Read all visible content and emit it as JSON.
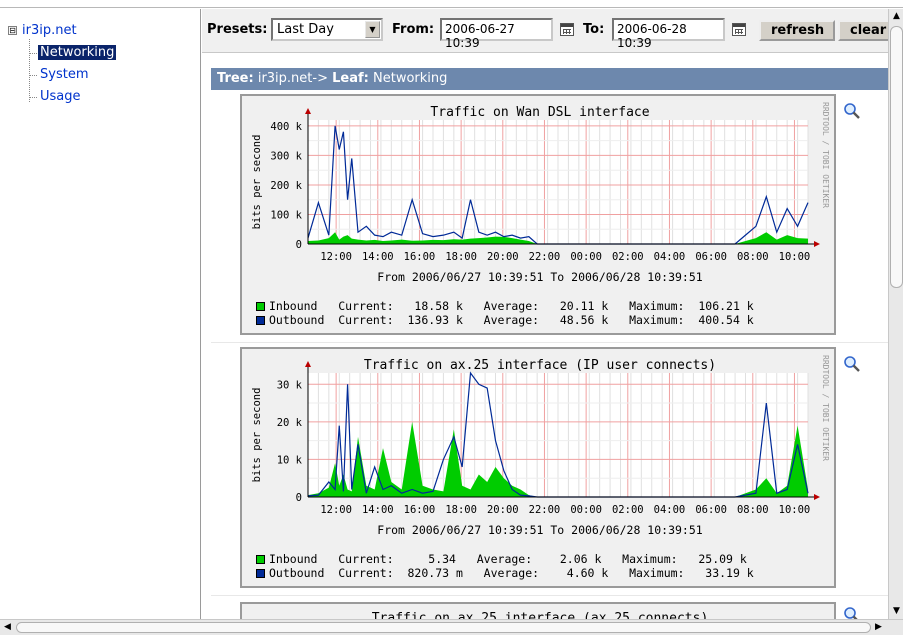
{
  "tree": {
    "root": "ir3ip.net",
    "expander": "⊟",
    "items": [
      "Networking",
      "System",
      "Usage"
    ],
    "selected_index": 0
  },
  "toolbar": {
    "presets_label": "Presets:",
    "preset_value": "Last Day",
    "from_label": "From:",
    "from_value": "2006-06-27 10:39",
    "to_label": "To:",
    "to_value": "2006-06-28 10:39",
    "refresh_label": "refresh",
    "clear_label": "clear"
  },
  "header": {
    "tree_label": "Tree:",
    "tree_value": "ir3ip.net->",
    "leaf_label": "Leaf:",
    "leaf_value": "Networking"
  },
  "colors": {
    "inbound": "#00cc00",
    "outbound": "#002a97",
    "header_bg": "#6d88ad",
    "selected_bg": "#0a246a"
  },
  "graphs": [
    {
      "title": "Traffic on Wan DSL interface",
      "watermark": "RRDTOOL / TOBI OETIKER",
      "period": "From 2006/06/27 10:39:51 To 2006/06/28 10:39:51",
      "legend": [
        {
          "name": "Inbound",
          "current": "18.58 k",
          "average": "20.11 k",
          "maximum": "106.21 k"
        },
        {
          "name": "Outbound",
          "current": "136.93 k",
          "average": "48.56 k",
          "maximum": "400.54 k"
        }
      ]
    },
    {
      "title": "Traffic on ax.25 interface (IP user connects)",
      "watermark": "RRDTOOL / TOBI OETIKER",
      "period": "From 2006/06/27 10:39:51 To 2006/06/28 10:39:51",
      "legend": [
        {
          "name": "Inbound",
          "current": "5.34",
          "average": "2.06 k",
          "maximum": "25.09 k"
        },
        {
          "name": "Outbound",
          "current": "820.73 m",
          "average": "4.60 k",
          "maximum": "33.19 k"
        }
      ]
    },
    {
      "title": "Traffic on ax.25 interface (ax.25 connects)"
    }
  ],
  "legend_labels": {
    "current": "Current:",
    "average": "Average:",
    "maximum": "Maximum:"
  },
  "chart_data": [
    {
      "type": "area",
      "title": "Traffic on Wan DSL interface",
      "ylabel": "bits per second",
      "xlabel": "",
      "x_tick_labels": [
        "12:00",
        "14:00",
        "16:00",
        "18:00",
        "20:00",
        "22:00",
        "00:00",
        "02:00",
        "04:00",
        "06:00",
        "08:00",
        "10:00"
      ],
      "y_tick_labels": [
        "0",
        "100 k",
        "200 k",
        "300 k",
        "400 k"
      ],
      "ylim": [
        0,
        420000
      ],
      "x_hours": [
        0,
        0.5,
        1,
        1.3,
        1.5,
        1.7,
        1.9,
        2.1,
        2.4,
        2.8,
        3.2,
        3.6,
        4,
        4.5,
        5,
        5.5,
        6,
        6.5,
        7,
        7.4,
        7.8,
        8.2,
        8.6,
        9,
        9.4,
        9.8,
        10.2,
        10.6,
        11,
        11.5,
        12,
        12.5,
        13,
        13.5,
        14,
        14.5,
        15,
        15.5,
        16,
        16.5,
        17,
        17.5,
        18,
        18.5,
        19,
        19.5,
        20,
        20.5,
        21,
        21.5,
        22,
        22.5,
        23,
        23.5,
        24
      ],
      "series": [
        {
          "name": "Inbound",
          "values": [
            10000,
            12000,
            20000,
            40000,
            15000,
            25000,
            30000,
            18000,
            15000,
            12000,
            14000,
            10000,
            12000,
            15000,
            11000,
            12000,
            14000,
            13000,
            16000,
            15000,
            18000,
            20000,
            22000,
            25000,
            24000,
            20000,
            15000,
            10000,
            0,
            0,
            0,
            0,
            0,
            0,
            0,
            0,
            0,
            0,
            0,
            0,
            0,
            0,
            0,
            0,
            0,
            0,
            0,
            0,
            10000,
            20000,
            40000,
            15000,
            30000,
            20000,
            18000
          ]
        },
        {
          "name": "Outbound",
          "values": [
            20000,
            140000,
            30000,
            400000,
            320000,
            380000,
            150000,
            290000,
            40000,
            60000,
            30000,
            25000,
            40000,
            30000,
            150000,
            35000,
            25000,
            30000,
            40000,
            20000,
            150000,
            40000,
            30000,
            40000,
            25000,
            30000,
            20000,
            25000,
            0,
            0,
            0,
            0,
            0,
            0,
            0,
            0,
            0,
            0,
            0,
            0,
            0,
            0,
            0,
            0,
            0,
            0,
            0,
            0,
            30000,
            60000,
            160000,
            40000,
            120000,
            60000,
            140000
          ]
        }
      ]
    },
    {
      "type": "area",
      "title": "Traffic on ax.25 interface (IP user connects)",
      "ylabel": "bits per second",
      "xlabel": "",
      "x_tick_labels": [
        "12:00",
        "14:00",
        "16:00",
        "18:00",
        "20:00",
        "22:00",
        "00:00",
        "02:00",
        "04:00",
        "06:00",
        "08:00",
        "10:00"
      ],
      "y_tick_labels": [
        "0",
        "10 k",
        "20 k",
        "30 k"
      ],
      "ylim": [
        0,
        33000
      ],
      "x_hours": [
        0,
        0.5,
        1,
        1.3,
        1.5,
        1.7,
        1.9,
        2.1,
        2.4,
        2.8,
        3.2,
        3.6,
        4,
        4.5,
        5,
        5.5,
        6,
        6.5,
        7,
        7.4,
        7.8,
        8.2,
        8.6,
        9,
        9.4,
        9.8,
        10.2,
        10.6,
        11,
        11.5,
        12,
        12.5,
        13,
        13.5,
        14,
        14.5,
        15,
        15.5,
        16,
        16.5,
        17,
        17.5,
        18,
        18.5,
        19,
        19.5,
        20,
        20.5,
        21,
        21.5,
        22,
        22.5,
        23,
        23.5,
        24
      ],
      "series": [
        {
          "name": "Inbound",
          "values": [
            500,
            1000,
            2500,
            9000,
            3000,
            6000,
            2000,
            1500,
            16000,
            3000,
            2000,
            13000,
            4000,
            2000,
            20000,
            3000,
            2000,
            1500,
            18000,
            3000,
            2000,
            6000,
            4000,
            8000,
            5000,
            3000,
            2000,
            500,
            0,
            0,
            0,
            0,
            0,
            0,
            0,
            0,
            0,
            0,
            0,
            0,
            0,
            0,
            0,
            0,
            0,
            0,
            0,
            0,
            1000,
            2000,
            5000,
            1000,
            3000,
            19000,
            2000
          ]
        },
        {
          "name": "Outbound",
          "values": [
            300,
            500,
            4000,
            2000,
            19000,
            1500,
            30000,
            2000,
            14000,
            1000,
            8000,
            2000,
            3000,
            1000,
            2000,
            1000,
            1500,
            10000,
            16000,
            8000,
            33000,
            30000,
            29000,
            15000,
            7000,
            2000,
            500,
            300,
            0,
            0,
            0,
            0,
            0,
            0,
            0,
            0,
            0,
            0,
            0,
            0,
            0,
            0,
            0,
            0,
            0,
            0,
            0,
            0,
            500,
            1000,
            25000,
            1000,
            2000,
            14000,
            1000
          ]
        }
      ]
    }
  ]
}
